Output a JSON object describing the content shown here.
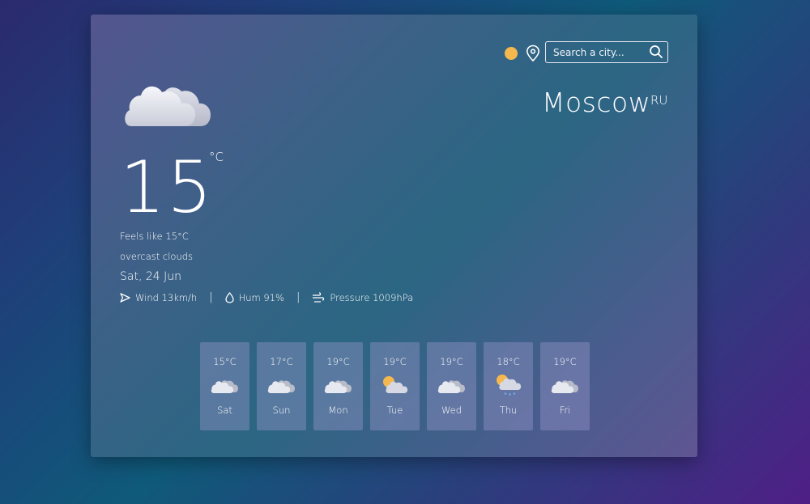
{
  "header": {
    "theme_toggle_icon": "sun-circle",
    "location_icon": "map-pin",
    "search": {
      "placeholder": "Search a city...",
      "value": ""
    }
  },
  "location": {
    "city": "Moscow",
    "country": "RU"
  },
  "current": {
    "condition_icon": "cloud",
    "temperature": "15",
    "unit": "°C",
    "feels_like": "Feels like 15°C",
    "description": "overcast clouds",
    "date": "Sat, 24 Jun",
    "wind": "Wind 13km/h",
    "humidity": "Hum 91%",
    "pressure": "Pressure 1009hPa",
    "separator": "|"
  },
  "forecast": [
    {
      "temp": "15°C",
      "day": "Sat",
      "icon": "cloud"
    },
    {
      "temp": "17°C",
      "day": "Sun",
      "icon": "cloud"
    },
    {
      "temp": "19°C",
      "day": "Mon",
      "icon": "cloud"
    },
    {
      "temp": "19°C",
      "day": "Tue",
      "icon": "sun-cloud"
    },
    {
      "temp": "19°C",
      "day": "Wed",
      "icon": "cloud"
    },
    {
      "temp": "18°C",
      "day": "Thu",
      "icon": "sun-cloud-rain"
    },
    {
      "temp": "19°C",
      "day": "Fri",
      "icon": "cloud"
    }
  ],
  "colors": {
    "sun": "#f5b84f",
    "card_tile": "rgba(150,150,200,0.42)",
    "rain": "#6fa8e8"
  }
}
